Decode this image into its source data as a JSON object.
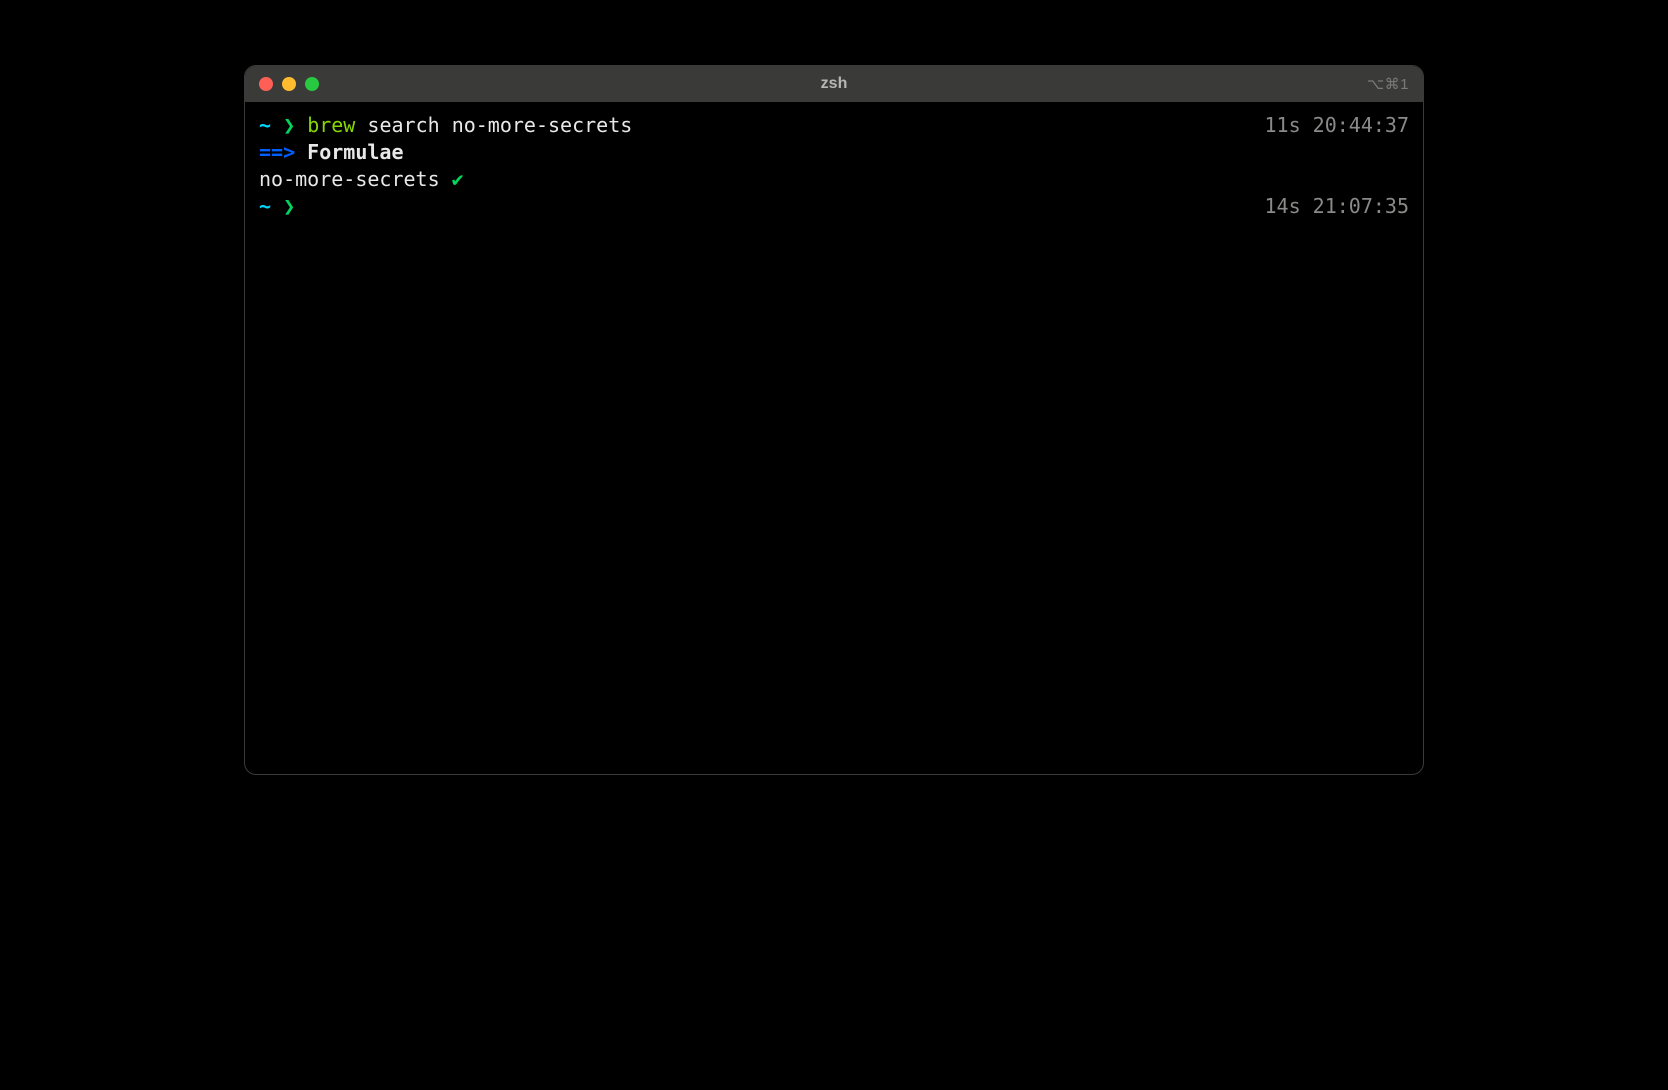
{
  "window": {
    "title": "zsh",
    "shortcut_hint": "⌥⌘1"
  },
  "prompt": {
    "tilde": "~",
    "chevron": "❯"
  },
  "lines": {
    "cmd1": {
      "command_head": "brew",
      "command_tail": " search no-more-secrets",
      "duration": "11s",
      "time": "20:44:37"
    },
    "out_header": {
      "arrow": "==>",
      "label": " Formulae"
    },
    "out_result": {
      "name": "no-more-secrets ",
      "check": "✔"
    },
    "cmd2": {
      "duration": "14s",
      "time": "21:07:35"
    }
  }
}
